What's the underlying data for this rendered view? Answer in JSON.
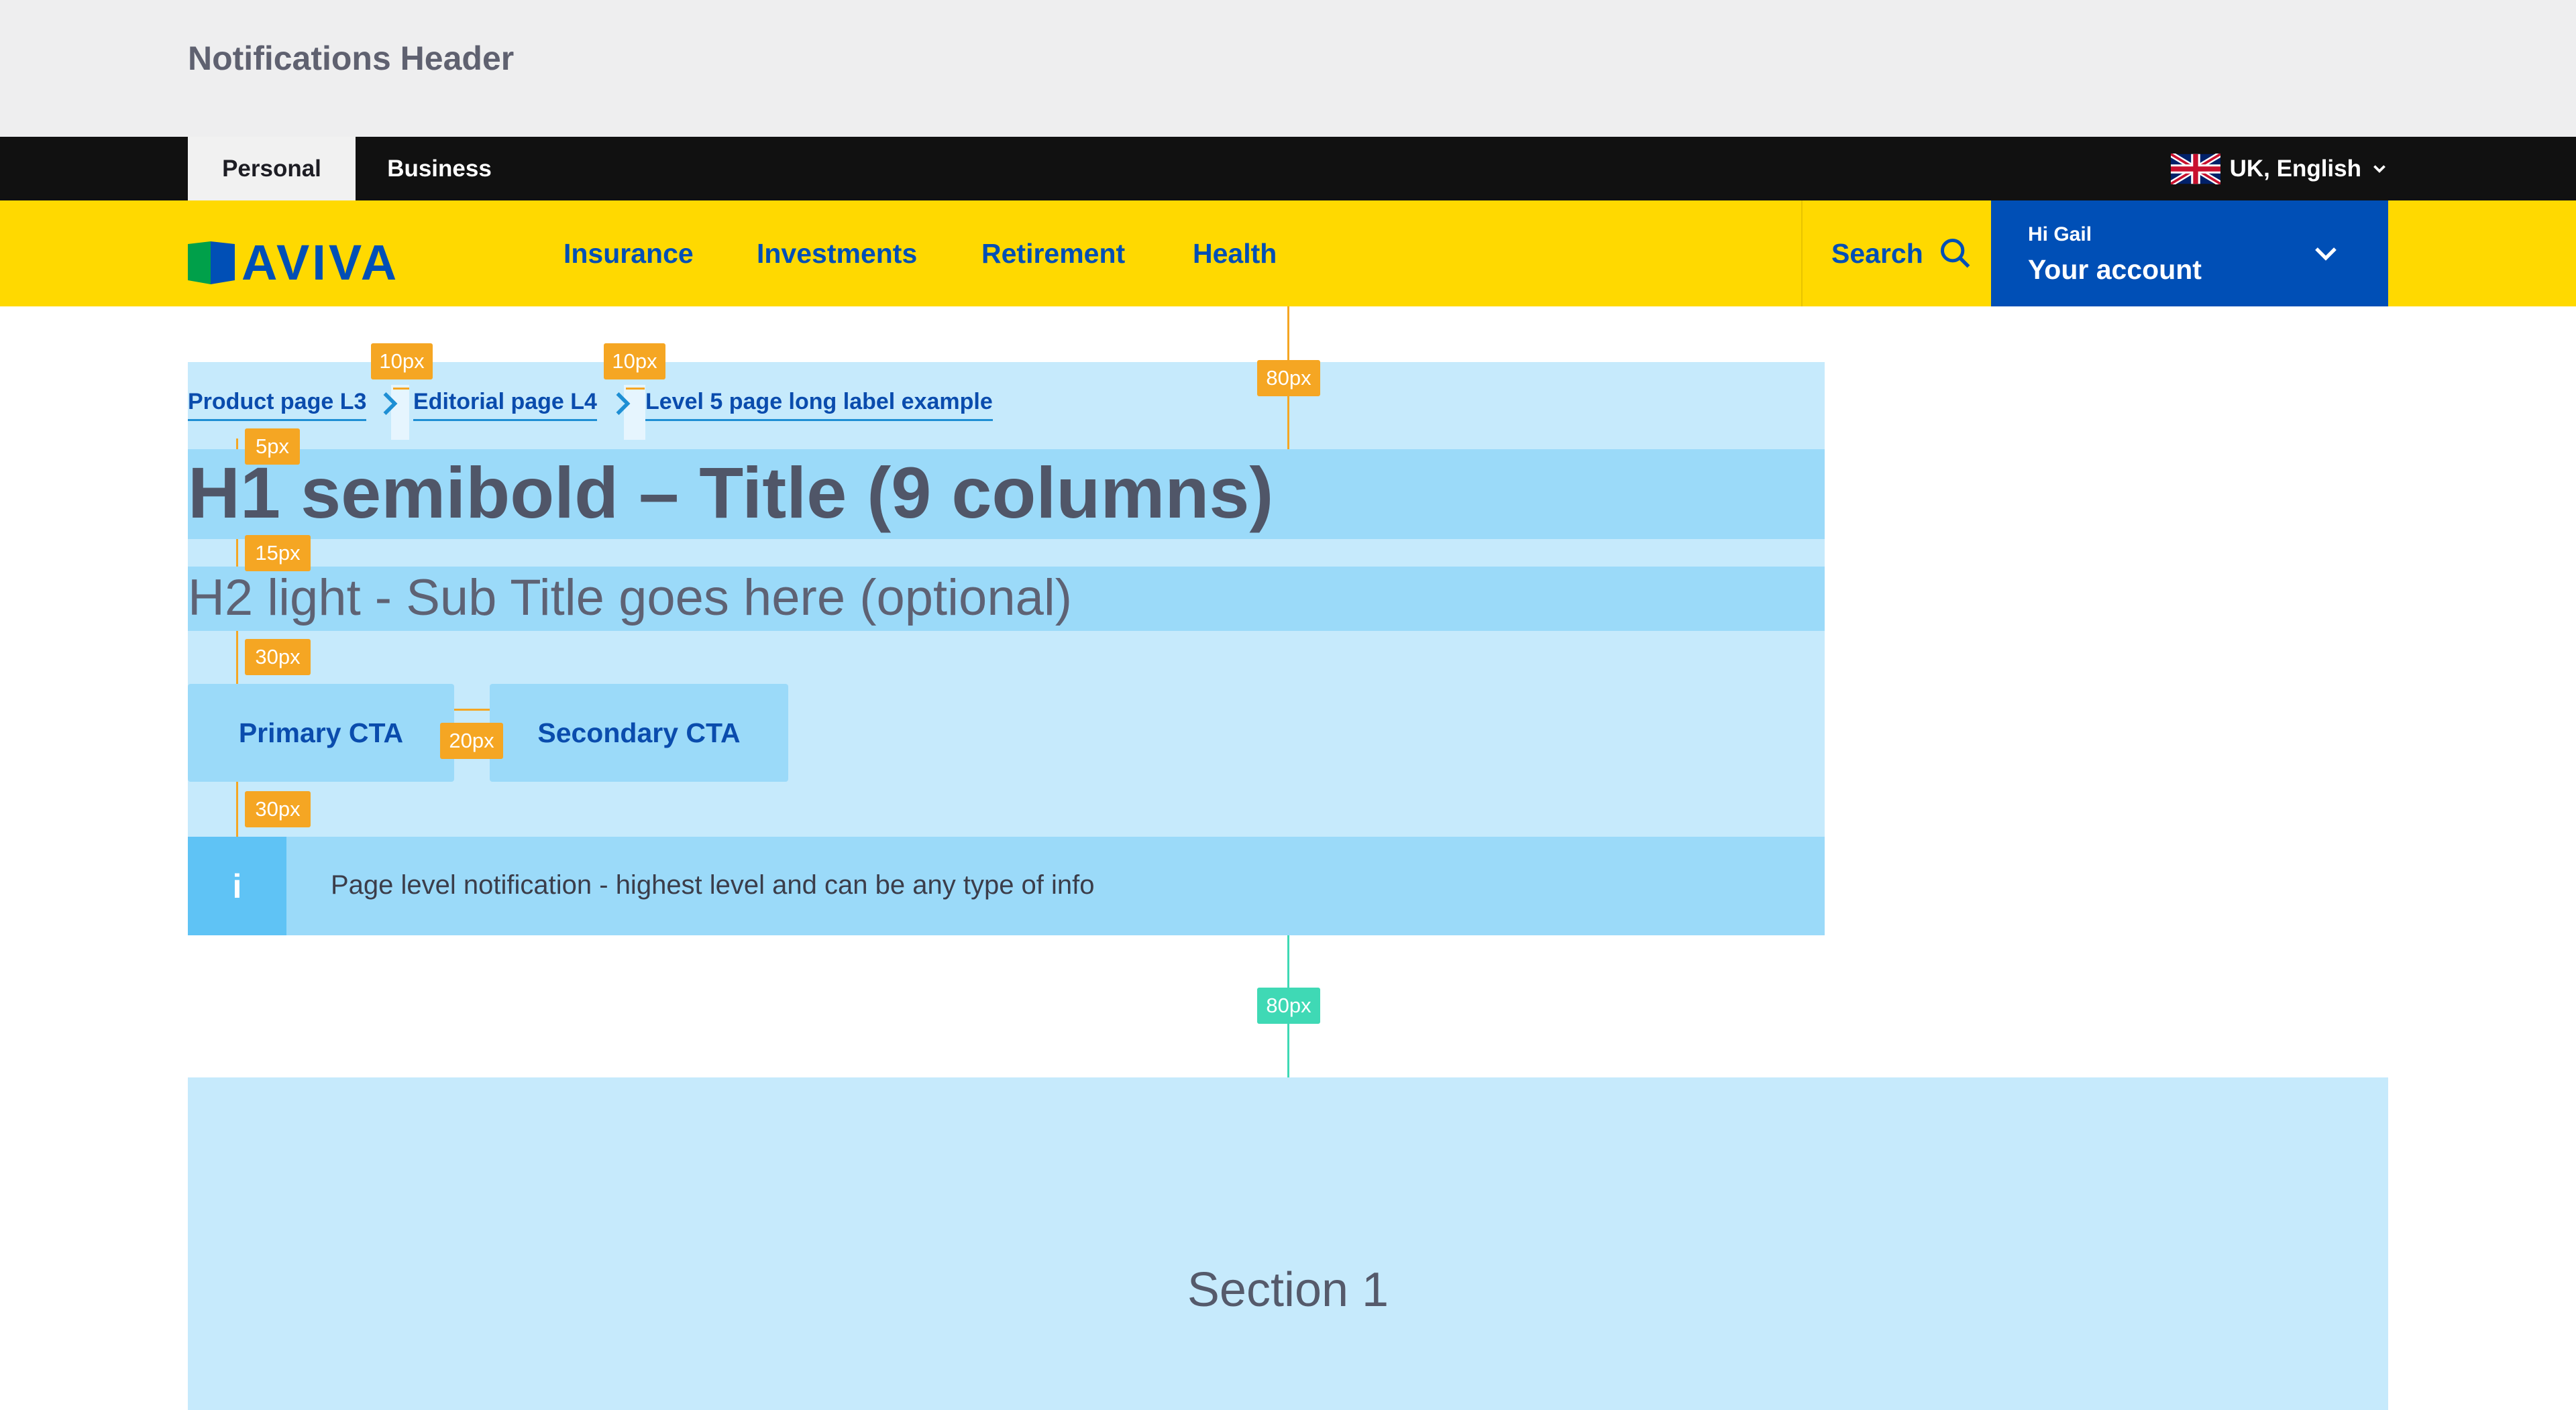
{
  "notification_header": {
    "title": "Notifications Header"
  },
  "segment_tabs": {
    "personal": "Personal",
    "business": "Business"
  },
  "language": {
    "label": "UK, English",
    "flag": "uk-flag-icon"
  },
  "brand": {
    "logo_text": "AVIVA",
    "colors": {
      "yellow": "#ffd900",
      "blue": "#004fb6",
      "green": "#00a04a"
    }
  },
  "nav": {
    "items": [
      "Insurance",
      "Investments",
      "Retirement",
      "Health"
    ],
    "search_label": "Search"
  },
  "account": {
    "greeting": "Hi Gail",
    "label": "Your account"
  },
  "breadcrumb": {
    "items": [
      "Product page L3",
      "Editorial page L4",
      "Level 5 page long label example"
    ]
  },
  "hero": {
    "title": "H1 semibold – Title (9 columns)",
    "subtitle": "H2 light - Sub Title goes here (optional)",
    "primary_cta": "Primary CTA",
    "secondary_cta": "Secondary CTA"
  },
  "notification": {
    "icon": "i",
    "text": "Page level notification - highest level and can be any type of info"
  },
  "section1": {
    "title": "Section 1"
  },
  "spacing_annotations": {
    "top_gap": "80px",
    "crumb_gap_1": "10px",
    "crumb_gap_2": "10px",
    "crumb_to_h1": "5px",
    "h1_to_h2": "15px",
    "h2_to_cta": "30px",
    "cta_gap": "20px",
    "cta_to_notice": "30px",
    "section_gap": "80px"
  }
}
